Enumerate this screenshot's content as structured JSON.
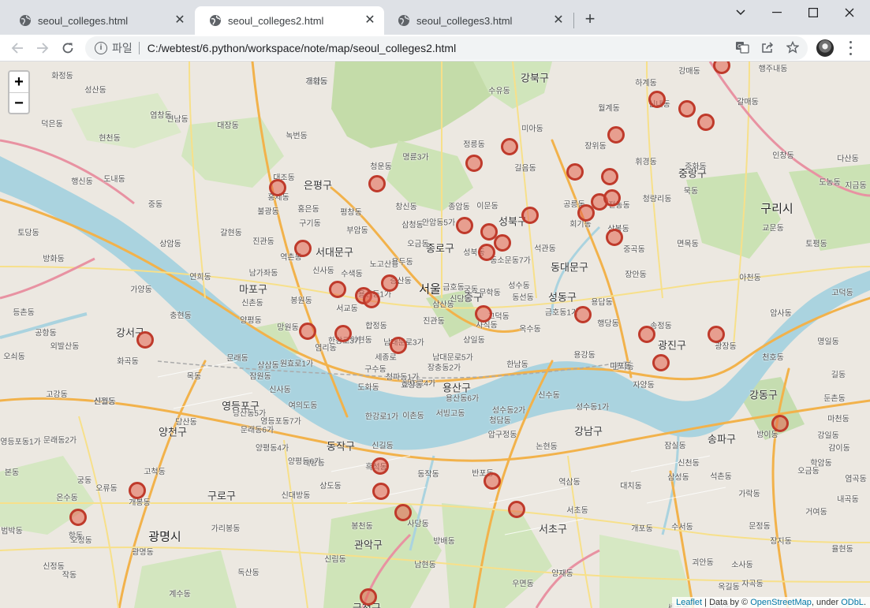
{
  "browser": {
    "tabs": [
      {
        "title": "seoul_colleges.html",
        "active": false
      },
      {
        "title": "seoul_colleges2.html",
        "active": true
      },
      {
        "title": "seoul_colleges3.html",
        "active": false
      }
    ],
    "close_symbol": "✕",
    "new_tab_symbol": "+",
    "address": {
      "scheme_label": "파일",
      "url": "C:/webtest/6.python/workspace/note/map/seoul_colleges2.html"
    },
    "icons": [
      "back-arrow-icon",
      "forward-arrow-icon",
      "reload-icon",
      "info-icon",
      "translate-icon",
      "share-icon",
      "bookmark-star-icon",
      "profile-avatar",
      "kebab-menu-icon"
    ]
  },
  "map": {
    "zoom_in": "+",
    "zoom_out": "−",
    "attribution": {
      "leaflet": "Leaflet",
      "sep": " | Data by © ",
      "osm": "OpenStreetMap",
      "under": ", under ",
      "odbl": "ODbL",
      "end": "."
    },
    "colors": {
      "marker_fill": "#e4604c",
      "marker_stroke": "#bf3a2b",
      "water": "#aad3df",
      "park": "#c8dfb5"
    },
    "labels": [
      {
        "text": "강북구",
        "cls": "district"
      },
      {
        "text": "은평구",
        "cls": "district"
      },
      {
        "text": "종로구",
        "cls": "district"
      },
      {
        "text": "성북구",
        "cls": "district"
      },
      {
        "text": "중랑구",
        "cls": "district"
      },
      {
        "text": "구리시",
        "cls": "big"
      },
      {
        "text": "서대문구",
        "cls": "district"
      },
      {
        "text": "동대문구",
        "cls": "district"
      },
      {
        "text": "마포구",
        "cls": "district"
      },
      {
        "text": "서울",
        "cls": "big"
      },
      {
        "text": "중구",
        "cls": "district"
      },
      {
        "text": "성동구",
        "cls": "district"
      },
      {
        "text": "강서구",
        "cls": "district"
      },
      {
        "text": "광진구",
        "cls": "district"
      },
      {
        "text": "용산구",
        "cls": "district"
      },
      {
        "text": "영등포구",
        "cls": "district"
      },
      {
        "text": "강동구",
        "cls": "district"
      },
      {
        "text": "양천구",
        "cls": "district"
      },
      {
        "text": "동작구",
        "cls": "district"
      },
      {
        "text": "강남구",
        "cls": "district"
      },
      {
        "text": "송파구",
        "cls": "district"
      },
      {
        "text": "구로구",
        "cls": "district"
      },
      {
        "text": "서초구",
        "cls": "district"
      },
      {
        "text": "광명시",
        "cls": "big"
      },
      {
        "text": "관악구",
        "cls": "district"
      },
      {
        "text": "금천구",
        "cls": "district"
      },
      {
        "text": "수유동",
        "cls": ""
      },
      {
        "text": "미아동",
        "cls": ""
      },
      {
        "text": "정릉동",
        "cls": ""
      },
      {
        "text": "길음동",
        "cls": ""
      },
      {
        "text": "하계동",
        "cls": ""
      },
      {
        "text": "월계동",
        "cls": ""
      },
      {
        "text": "장위동",
        "cls": ""
      },
      {
        "text": "갈매동",
        "cls": ""
      },
      {
        "text": "인창동",
        "cls": ""
      },
      {
        "text": "다산동",
        "cls": ""
      },
      {
        "text": "도농동",
        "cls": ""
      },
      {
        "text": "지금동",
        "cls": ""
      },
      {
        "text": "교문동",
        "cls": ""
      },
      {
        "text": "토평동",
        "cls": ""
      },
      {
        "text": "아천동",
        "cls": ""
      },
      {
        "text": "고덕동",
        "cls": ""
      },
      {
        "text": "암사동",
        "cls": ""
      },
      {
        "text": "명일동",
        "cls": ""
      },
      {
        "text": "천호동",
        "cls": ""
      },
      {
        "text": "길동",
        "cls": ""
      },
      {
        "text": "둔촌동",
        "cls": ""
      },
      {
        "text": "방이동",
        "cls": ""
      },
      {
        "text": "오금동",
        "cls": ""
      },
      {
        "text": "가락동",
        "cls": ""
      },
      {
        "text": "거여동",
        "cls": ""
      },
      {
        "text": "문정동",
        "cls": ""
      },
      {
        "text": "장지동",
        "cls": ""
      },
      {
        "text": "잠실동",
        "cls": ""
      },
      {
        "text": "신천동",
        "cls": ""
      },
      {
        "text": "석촌동",
        "cls": ""
      },
      {
        "text": "삼성동",
        "cls": ""
      },
      {
        "text": "대치동",
        "cls": ""
      },
      {
        "text": "역삼동",
        "cls": ""
      },
      {
        "text": "개포동",
        "cls": ""
      },
      {
        "text": "수서동",
        "cls": ""
      },
      {
        "text": "논현동",
        "cls": ""
      },
      {
        "text": "반포동",
        "cls": ""
      },
      {
        "text": "서초동",
        "cls": ""
      },
      {
        "text": "양재동",
        "cls": ""
      },
      {
        "text": "우면동",
        "cls": ""
      },
      {
        "text": "방배동",
        "cls": ""
      },
      {
        "text": "사당동",
        "cls": ""
      },
      {
        "text": "흑석동",
        "cls": ""
      },
      {
        "text": "동작동",
        "cls": ""
      },
      {
        "text": "상도동",
        "cls": ""
      },
      {
        "text": "봉천동",
        "cls": ""
      },
      {
        "text": "신림동",
        "cls": ""
      },
      {
        "text": "남현동",
        "cls": ""
      },
      {
        "text": "대방동",
        "cls": ""
      },
      {
        "text": "신대방동",
        "cls": ""
      },
      {
        "text": "가리봉동",
        "cls": ""
      },
      {
        "text": "개봉동",
        "cls": ""
      },
      {
        "text": "고척동",
        "cls": ""
      },
      {
        "text": "오류동",
        "cls": ""
      },
      {
        "text": "온수동",
        "cls": ""
      },
      {
        "text": "궁동",
        "cls": ""
      },
      {
        "text": "항동",
        "cls": ""
      },
      {
        "text": "광명동",
        "cls": ""
      },
      {
        "text": "독산동",
        "cls": ""
      },
      {
        "text": "신정동",
        "cls": ""
      },
      {
        "text": "신월동",
        "cls": ""
      },
      {
        "text": "목동",
        "cls": ""
      },
      {
        "text": "화곡동",
        "cls": ""
      },
      {
        "text": "등촌동",
        "cls": ""
      },
      {
        "text": "가양동",
        "cls": ""
      },
      {
        "text": "방화동",
        "cls": ""
      },
      {
        "text": "공항동",
        "cls": ""
      },
      {
        "text": "외발산동",
        "cls": ""
      },
      {
        "text": "오쇠동",
        "cls": ""
      },
      {
        "text": "고강동",
        "cls": ""
      },
      {
        "text": "여의도동",
        "cls": ""
      },
      {
        "text": "당산동",
        "cls": ""
      },
      {
        "text": "문래동",
        "cls": ""
      },
      {
        "text": "양평동",
        "cls": ""
      },
      {
        "text": "망원동",
        "cls": ""
      },
      {
        "text": "서교동",
        "cls": ""
      },
      {
        "text": "노고산동",
        "cls": ""
      },
      {
        "text": "합정동",
        "cls": ""
      },
      {
        "text": "아현동",
        "cls": ""
      },
      {
        "text": "염리동",
        "cls": ""
      },
      {
        "text": "구수동",
        "cls": ""
      },
      {
        "text": "도화동",
        "cls": ""
      },
      {
        "text": "원효로4가",
        "cls": ""
      },
      {
        "text": "한강로1가",
        "cls": ""
      },
      {
        "text": "이촌동",
        "cls": ""
      },
      {
        "text": "서빙고동",
        "cls": ""
      },
      {
        "text": "용산동6가",
        "cls": ""
      },
      {
        "text": "한남동",
        "cls": ""
      },
      {
        "text": "옥수동",
        "cls": ""
      },
      {
        "text": "금호동1가",
        "cls": ""
      },
      {
        "text": "행당동",
        "cls": ""
      },
      {
        "text": "송정동",
        "cls": ""
      },
      {
        "text": "군자동",
        "cls": ""
      },
      {
        "text": "자양동",
        "cls": ""
      },
      {
        "text": "광장동",
        "cls": ""
      },
      {
        "text": "용답동",
        "cls": ""
      },
      {
        "text": "장안동",
        "cls": ""
      },
      {
        "text": "면목동",
        "cls": ""
      },
      {
        "text": "중곡동",
        "cls": ""
      },
      {
        "text": "회기동",
        "cls": ""
      },
      {
        "text": "전농동",
        "cls": ""
      },
      {
        "text": "청량리동",
        "cls": ""
      },
      {
        "text": "휘경동",
        "cls": ""
      },
      {
        "text": "중화동",
        "cls": ""
      },
      {
        "text": "묵동",
        "cls": ""
      },
      {
        "text": "신내동",
        "cls": ""
      },
      {
        "text": "상봉동",
        "cls": ""
      },
      {
        "text": "공릉동",
        "cls": ""
      },
      {
        "text": "석관동",
        "cls": ""
      },
      {
        "text": "이문동",
        "cls": ""
      },
      {
        "text": "종암동",
        "cls": ""
      },
      {
        "text": "안암동5가",
        "cls": ""
      },
      {
        "text": "동소문동7가",
        "cls": ""
      },
      {
        "text": "성북동",
        "cls": ""
      },
      {
        "text": "삼청동",
        "cls": ""
      },
      {
        "text": "창신동",
        "cls": ""
      },
      {
        "text": "명륜3가",
        "cls": ""
      },
      {
        "text": "청운동",
        "cls": ""
      },
      {
        "text": "부암동",
        "cls": ""
      },
      {
        "text": "평창동",
        "cls": ""
      },
      {
        "text": "구기동",
        "cls": ""
      },
      {
        "text": "홍제동",
        "cls": ""
      },
      {
        "text": "홍은동",
        "cls": ""
      },
      {
        "text": "녹번동",
        "cls": ""
      },
      {
        "text": "응암동",
        "cls": ""
      },
      {
        "text": "대조동",
        "cls": ""
      },
      {
        "text": "불광동",
        "cls": ""
      },
      {
        "text": "갈현동",
        "cls": ""
      },
      {
        "text": "진관동",
        "cls": ""
      },
      {
        "text": "역촌동",
        "cls": ""
      },
      {
        "text": "신사동",
        "cls": ""
      },
      {
        "text": "수색동",
        "cls": ""
      },
      {
        "text": "증산동",
        "cls": ""
      },
      {
        "text": "남가좌동",
        "cls": ""
      },
      {
        "text": "연희동",
        "cls": ""
      },
      {
        "text": "신촌동",
        "cls": ""
      },
      {
        "text": "봉원동",
        "cls": ""
      },
      {
        "text": "충현동",
        "cls": ""
      },
      {
        "text": "중동",
        "cls": ""
      },
      {
        "text": "상암동",
        "cls": ""
      },
      {
        "text": "성산동",
        "cls": ""
      },
      {
        "text": "연남동",
        "cls": ""
      },
      {
        "text": "염창동",
        "cls": ""
      },
      {
        "text": "현천동",
        "cls": ""
      },
      {
        "text": "덕은동",
        "cls": ""
      },
      {
        "text": "화정동",
        "cls": ""
      },
      {
        "text": "도내동",
        "cls": ""
      },
      {
        "text": "행신동",
        "cls": ""
      },
      {
        "text": "토당동",
        "cls": ""
      },
      {
        "text": "대장동",
        "cls": ""
      },
      {
        "text": "강매동",
        "cls": ""
      },
      {
        "text": "행주내동",
        "cls": ""
      },
      {
        "text": "개화동",
        "cls": ""
      },
      {
        "text": "용두동",
        "cls": ""
      },
      {
        "text": "오금동",
        "cls": ""
      },
      {
        "text": "삼산동",
        "cls": ""
      },
      {
        "text": "진관동",
        "cls": ""
      },
      {
        "text": "사직동",
        "cls": ""
      },
      {
        "text": "세종로",
        "cls": ""
      },
      {
        "text": "남대문로3가",
        "cls": ""
      },
      {
        "text": "남대문로5가",
        "cls": ""
      },
      {
        "text": "장충동2가",
        "cls": ""
      },
      {
        "text": "효창동",
        "cls": ""
      },
      {
        "text": "청파동1가",
        "cls": ""
      },
      {
        "text": "용산동1가",
        "cls": ""
      },
      {
        "text": "한강로3가",
        "cls": ""
      },
      {
        "text": "원효로1가",
        "cls": ""
      },
      {
        "text": "용강동",
        "cls": ""
      },
      {
        "text": "마포동",
        "cls": ""
      },
      {
        "text": "신수동",
        "cls": ""
      },
      {
        "text": "성수동1가",
        "cls": ""
      },
      {
        "text": "성수동2가",
        "cls": ""
      },
      {
        "text": "압구정동",
        "cls": ""
      },
      {
        "text": "청담동",
        "cls": ""
      },
      {
        "text": "신사동",
        "cls": ""
      },
      {
        "text": "잠원동",
        "cls": ""
      },
      {
        "text": "상삼동",
        "cls": ""
      },
      {
        "text": "영등포동7가",
        "cls": ""
      },
      {
        "text": "당산동5가",
        "cls": ""
      },
      {
        "text": "양평동4가",
        "cls": ""
      },
      {
        "text": "문래동6가",
        "cls": ""
      },
      {
        "text": "신길동",
        "cls": ""
      },
      {
        "text": "양평동6가",
        "cls": ""
      },
      {
        "text": "영등포동1가",
        "cls": ""
      },
      {
        "text": "문래동2가",
        "cls": ""
      },
      {
        "text": "본동",
        "cls": ""
      },
      {
        "text": "신정동",
        "cls": ""
      },
      {
        "text": "작동",
        "cls": ""
      },
      {
        "text": "오정동",
        "cls": ""
      },
      {
        "text": "범박동",
        "cls": ""
      },
      {
        "text": "계수동",
        "cls": ""
      },
      {
        "text": "옥길동",
        "cls": ""
      },
      {
        "text": "괴안동",
        "cls": ""
      },
      {
        "text": "소사동",
        "cls": ""
      },
      {
        "text": "하안동",
        "cls": ""
      },
      {
        "text": "세곡동",
        "cls": ""
      },
      {
        "text": "자곡동",
        "cls": ""
      },
      {
        "text": "율현동",
        "cls": ""
      },
      {
        "text": "내곡동",
        "cls": ""
      },
      {
        "text": "염곡동",
        "cls": ""
      },
      {
        "text": "학암동",
        "cls": ""
      },
      {
        "text": "마천동",
        "cls": ""
      },
      {
        "text": "감이동",
        "cls": ""
      },
      {
        "text": "강일동",
        "cls": ""
      },
      {
        "text": "고덕동",
        "cls": ""
      },
      {
        "text": "상일동",
        "cls": ""
      },
      {
        "text": "동선동",
        "cls": ""
      },
      {
        "text": "성수동",
        "cls": ""
      },
      {
        "text": "궁동",
        "cls": ""
      },
      {
        "text": "금호동",
        "cls": ""
      },
      {
        "text": "무학동",
        "cls": ""
      },
      {
        "text": "신당동",
        "cls": ""
      },
      {
        "text": "상왕십리동",
        "cls": ""
      },
      {
        "text": "종로4가",
        "cls": ""
      },
      {
        "text": "권지동",
        "cls": ""
      },
      {
        "text": "필동",
        "cls": ""
      },
      {
        "text": "을지로",
        "cls": ""
      }
    ]
  }
}
